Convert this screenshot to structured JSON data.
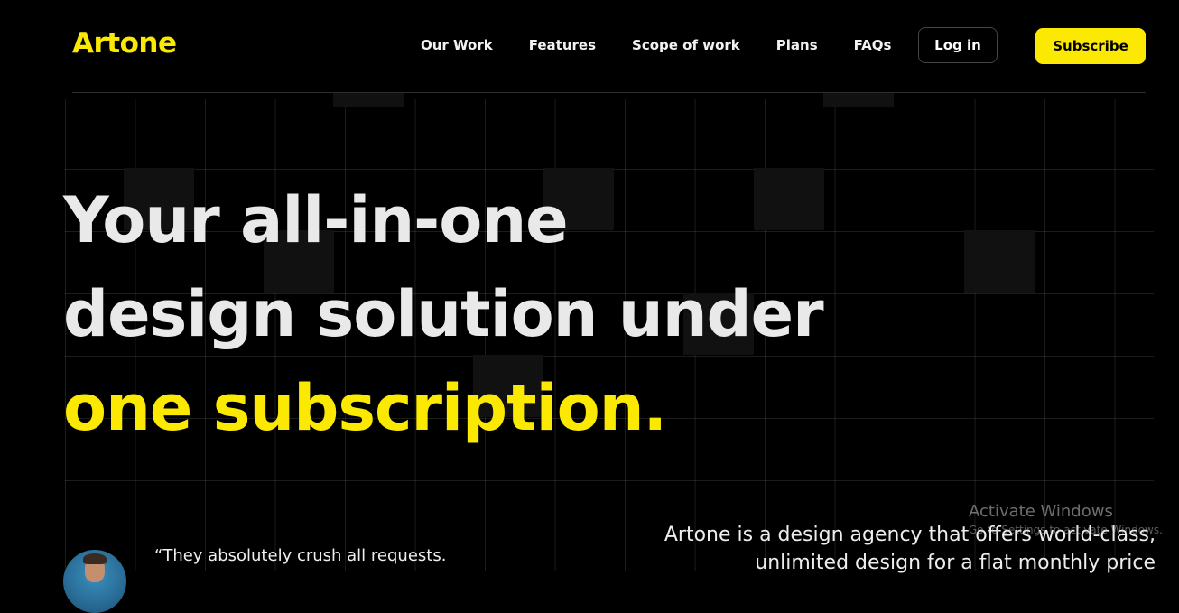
{
  "brand": {
    "name": "Artone",
    "accent_color": "#fbe902"
  },
  "nav": {
    "items": [
      {
        "label": "Our Work"
      },
      {
        "label": "Features"
      },
      {
        "label": "Scope of work"
      },
      {
        "label": "Plans"
      },
      {
        "label": "FAQs"
      }
    ],
    "login_label": "Log in",
    "subscribe_label": "Subscribe"
  },
  "hero": {
    "line1": "Your all-in-one",
    "line2": "design solution under",
    "line3": "one subscription."
  },
  "testimonial": {
    "quote": "“They absolutely crush all requests."
  },
  "description": {
    "text": "Artone is a design agency that offers world-class, unlimited design for a flat monthly price"
  },
  "overlay": {
    "activate_title": "Activate Windows",
    "activate_subtitle": "Go to Settings to activate Windows."
  }
}
